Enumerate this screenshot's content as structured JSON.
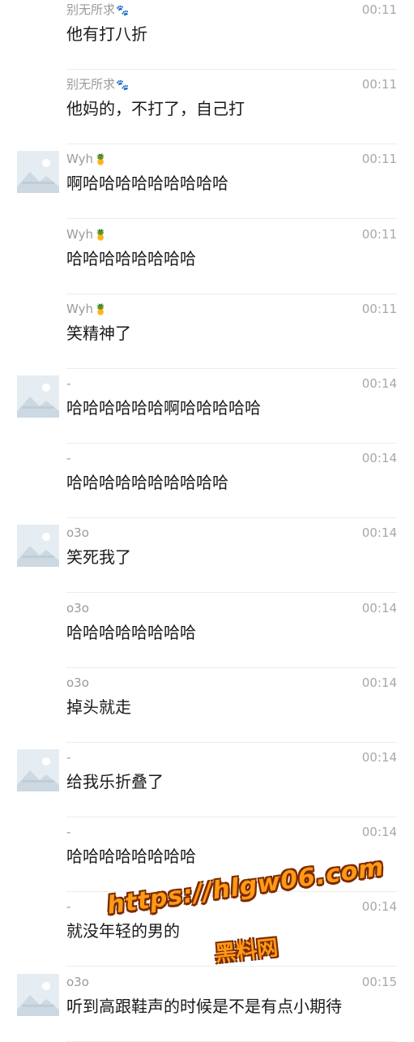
{
  "messages": [
    {
      "sender": "别无所求",
      "sender_icon": "paw-icon",
      "time": "00:11",
      "text": "他有打八折",
      "has_avatar": false
    },
    {
      "sender": "别无所求",
      "sender_icon": "paw-icon",
      "time": "00:11",
      "text": "他妈的，不打了，自己打",
      "has_avatar": false
    },
    {
      "sender": "Wyh",
      "sender_icon": "pineapple-icon",
      "time": "00:11",
      "text": "啊哈哈哈哈哈哈哈哈哈",
      "has_avatar": true
    },
    {
      "sender": "Wyh",
      "sender_icon": "pineapple-icon",
      "time": "00:11",
      "text": "哈哈哈哈哈哈哈哈",
      "has_avatar": false
    },
    {
      "sender": "Wyh",
      "sender_icon": "pineapple-icon",
      "time": "00:11",
      "text": "笑精神了",
      "has_avatar": false
    },
    {
      "sender": "-",
      "sender_icon": "",
      "time": "00:14",
      "text": "哈哈哈哈哈哈啊哈哈哈哈哈",
      "has_avatar": true
    },
    {
      "sender": "-",
      "sender_icon": "",
      "time": "00:14",
      "text": "哈哈哈哈哈哈哈哈哈哈",
      "has_avatar": false
    },
    {
      "sender": "o3o",
      "sender_icon": "",
      "time": "00:14",
      "text": "笑死我了",
      "has_avatar": true
    },
    {
      "sender": "o3o",
      "sender_icon": "",
      "time": "00:14",
      "text": "哈哈哈哈哈哈哈哈",
      "has_avatar": false
    },
    {
      "sender": "o3o",
      "sender_icon": "",
      "time": "00:14",
      "text": "掉头就走",
      "has_avatar": false
    },
    {
      "sender": "-",
      "sender_icon": "",
      "time": "00:14",
      "text": "给我乐折叠了",
      "has_avatar": true
    },
    {
      "sender": "-",
      "sender_icon": "",
      "time": "00:14",
      "text": "哈哈哈哈哈哈哈哈",
      "has_avatar": false
    },
    {
      "sender": "-",
      "sender_icon": "",
      "time": "00:14",
      "text": "就没年轻的男的",
      "has_avatar": false
    },
    {
      "sender": "o3o",
      "sender_icon": "",
      "time": "00:15",
      "text": "听到高跟鞋声的时候是不是有点小期待",
      "has_avatar": true
    }
  ],
  "watermark": {
    "url": "https://hlgw06.com",
    "label": "黑料网"
  }
}
